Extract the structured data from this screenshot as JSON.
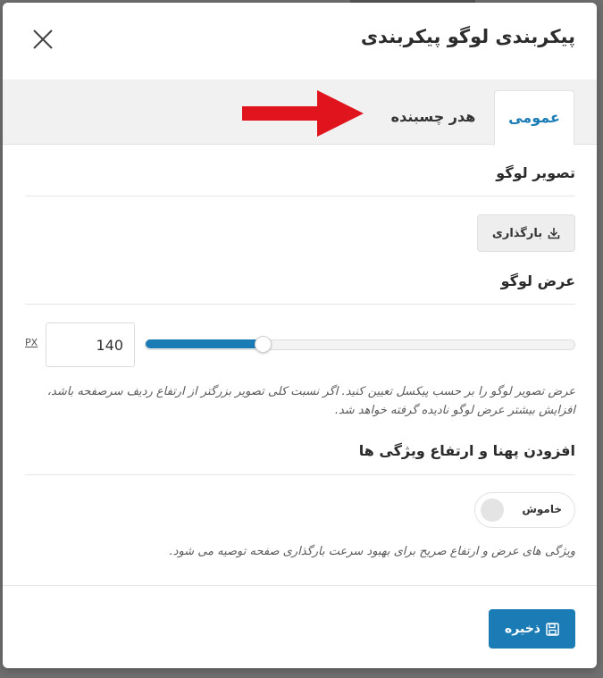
{
  "modal": {
    "title": "پیکربندی لوگو پیکربندی"
  },
  "tabs": [
    {
      "label": "عمومی",
      "active": true
    },
    {
      "label": "هدر چسبنده",
      "active": false
    }
  ],
  "logo_image": {
    "title": "تصویر لوگو",
    "upload_label": "بارگذاری"
  },
  "logo_width": {
    "title": "عرض لوگو",
    "value": "140",
    "unit": "PX",
    "slider_fraction": 0.27,
    "help": "عرض تصویر لوگو را بر حسب پیکسل تعیین کنید. اگر نسبت کلی تصویر بزرگتر از ارتفاع ردیف سرصفحه باشد، افزایش بیشتر عرض لوگو نادیده گرفته خواهد شد."
  },
  "dimensions": {
    "title": "افزودن پهنا و ارتفاع ویژگی ها",
    "toggle_label": "خاموش",
    "toggle_on": false,
    "help": "ویژگی های عرض و ارتفاع صریح برای بهبود سرعت بارگذاری صفحه توصیه می شود."
  },
  "footer": {
    "save_label": "ذخیره"
  },
  "colors": {
    "accent": "#1a7bb5",
    "arrow": "#e0141c"
  },
  "icons": {
    "close": "close-icon",
    "upload": "download-icon",
    "save": "floppy-disk-icon",
    "arrow": "red-arrow-annotation"
  }
}
